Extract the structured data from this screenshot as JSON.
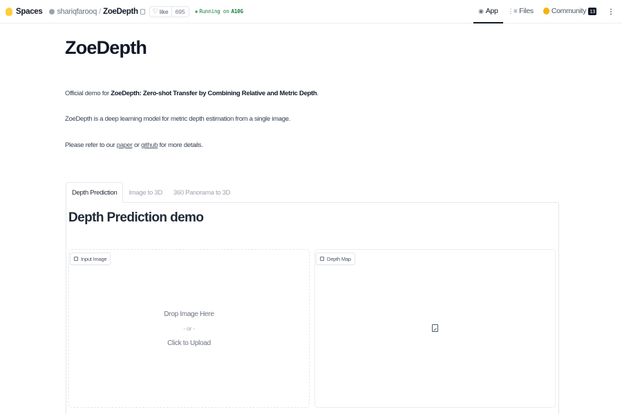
{
  "header": {
    "spaces_label": "Spaces",
    "owner": "shariqfarooq",
    "separator": "/",
    "repo": "ZoeDepth",
    "like_label": "like",
    "like_count": "695",
    "status_prefix": "Running on",
    "status_hardware": "A10G",
    "nav": {
      "app": "App",
      "files": "Files",
      "community": "Community",
      "community_count": "13"
    },
    "icons": {
      "spaces": "spaces-logo-icon",
      "copy": "copy-icon",
      "like": "heart-icon",
      "status": "bolt-icon",
      "more": "kebab-menu-icon"
    }
  },
  "intro": {
    "title": "ZoeDepth",
    "line1_prefix": "Official demo for ",
    "line1_bold": "ZoeDepth: Zero-shot Transfer by Combining Relative and Metric Depth",
    "line1_suffix": ".",
    "line2": "ZoeDepth is a deep learning model for metric depth estimation from a single image.",
    "line3_prefix": "Please refer to our ",
    "line3_link1": "paper",
    "line3_mid": " or ",
    "line3_link2": "github",
    "line3_suffix": " for more details."
  },
  "tabs": [
    {
      "label": "Depth Prediction",
      "active": true
    },
    {
      "label": "Image to 3D",
      "active": false
    },
    {
      "label": "360 Panorama to 3D",
      "active": false
    }
  ],
  "demo": {
    "title": "Depth Prediction demo",
    "input": {
      "label": "Input Image",
      "drop_text": "Drop Image Here",
      "or_text": "- or -",
      "upload_text": "Click to Upload"
    },
    "output": {
      "label": "Depth Map"
    }
  },
  "colors": {
    "status": "#15803d",
    "community_badge": "#111827",
    "spaces_logo": "#ffcd3c"
  }
}
